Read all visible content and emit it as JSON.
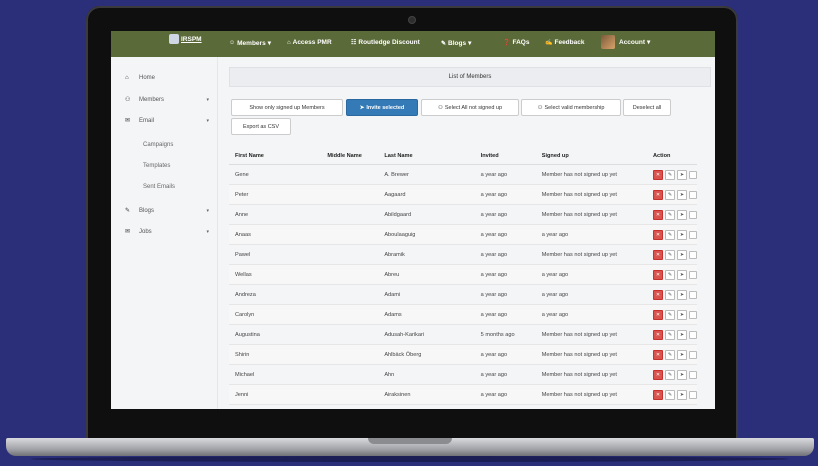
{
  "nav": {
    "brand": "IRSPM",
    "items": [
      {
        "icon": "user-icon",
        "glyph": "☺",
        "label": "Members",
        "dropdown": true
      },
      {
        "icon": "lock-icon",
        "glyph": "⌂",
        "label": "Access PMR",
        "dropdown": false
      },
      {
        "icon": "book-icon",
        "glyph": "☷",
        "label": "Routledge Discount",
        "dropdown": false
      },
      {
        "icon": "pencil-icon",
        "glyph": "✎",
        "label": "Blogs",
        "dropdown": true
      },
      {
        "icon": "question-icon",
        "glyph": "❓",
        "label": "FAQs",
        "dropdown": false
      },
      {
        "icon": "edit-icon",
        "glyph": "✍",
        "label": "Feedback",
        "dropdown": false
      }
    ],
    "account_label": "Account"
  },
  "sidebar": {
    "items": [
      {
        "icon": "home-icon",
        "glyph": "⌂",
        "label": "Home",
        "chevron": false
      },
      {
        "icon": "users-icon",
        "glyph": "⚇",
        "label": "Members",
        "chevron": true
      },
      {
        "icon": "envelope-icon",
        "glyph": "✉",
        "label": "Email",
        "chevron": true
      }
    ],
    "email_sub": [
      "Campaigns",
      "Templates",
      "Sent Emails"
    ],
    "items2": [
      {
        "icon": "pencil-icon",
        "glyph": "✎",
        "label": "Blogs",
        "chevron": true
      },
      {
        "icon": "briefcase-icon",
        "glyph": "✉",
        "label": "Jobs",
        "chevron": true
      }
    ]
  },
  "main": {
    "title": "List of Members",
    "buttons": {
      "show_signed_up": "Show only signed up Members",
      "invite_selected": "Invite selected",
      "select_not_signed": "Select All not signed up",
      "select_valid": "Select valid membership",
      "deselect_all": "Deselect all",
      "export_csv": "Export as CSV"
    },
    "columns": [
      "First Name",
      "Middle Name",
      "Last Name",
      "Invited",
      "Signed up",
      "Action"
    ],
    "rows": [
      {
        "first": "Gene",
        "middle": "",
        "last": "A. Brewer",
        "invited": "a year ago",
        "signed": "Member has not signed up yet"
      },
      {
        "first": "Peter",
        "middle": "",
        "last": "Aagaard",
        "invited": "a year ago",
        "signed": "Member has not signed up yet"
      },
      {
        "first": "Anne",
        "middle": "",
        "last": "Abildgaard",
        "invited": "a year ago",
        "signed": "Member has not signed up yet"
      },
      {
        "first": "Anaas",
        "middle": "",
        "last": "Aboulaaguig",
        "invited": "a year ago",
        "signed": "a year ago"
      },
      {
        "first": "Pawel",
        "middle": "",
        "last": "Abramik",
        "invited": "a year ago",
        "signed": "Member has not signed up yet"
      },
      {
        "first": "Wellas",
        "middle": "",
        "last": "Abreu",
        "invited": "a year ago",
        "signed": "a year ago"
      },
      {
        "first": "Andreza",
        "middle": "",
        "last": "Adami",
        "invited": "a year ago",
        "signed": "a year ago"
      },
      {
        "first": "Carolyn",
        "middle": "",
        "last": "Adams",
        "invited": "a year ago",
        "signed": "a year ago"
      },
      {
        "first": "Augustina",
        "middle": "",
        "last": "Adusah-Karikari",
        "invited": "5 months ago",
        "signed": "Member has not signed up yet"
      },
      {
        "first": "Shirin",
        "middle": "",
        "last": "Ahlbäck Öberg",
        "invited": "a year ago",
        "signed": "Member has not signed up yet"
      },
      {
        "first": "Michael",
        "middle": "",
        "last": "Ahn",
        "invited": "a year ago",
        "signed": "Member has not signed up yet"
      },
      {
        "first": "Jenni",
        "middle": "",
        "last": "Airaksinen",
        "invited": "a year ago",
        "signed": "Member has not signed up yet"
      }
    ]
  },
  "colors": {
    "navbar": "#5b6a39",
    "primary": "#337ab7",
    "danger": "#d9534f",
    "background": "#2b2f7a"
  }
}
